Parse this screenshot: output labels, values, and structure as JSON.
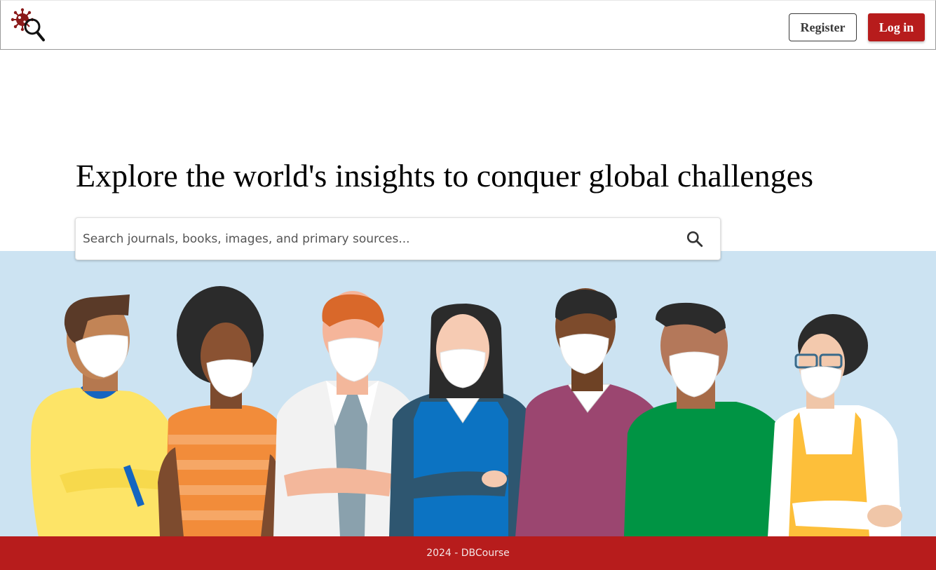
{
  "header": {
    "logo_icon": "virus-magnifier-icon",
    "register_label": "Register",
    "login_label": "Log in"
  },
  "hero": {
    "title": "Explore the world's insights to conquer global challenges"
  },
  "search": {
    "placeholder": "Search journals, books, images, and primary sources...",
    "value": "",
    "icon": "search-icon"
  },
  "illustration": {
    "icon": "masked-people-illustration"
  },
  "footer": {
    "text": "2024 - DBCourse"
  },
  "colors": {
    "brand_red": "#b71c1c",
    "illustration_bg": "#cce3f2"
  }
}
